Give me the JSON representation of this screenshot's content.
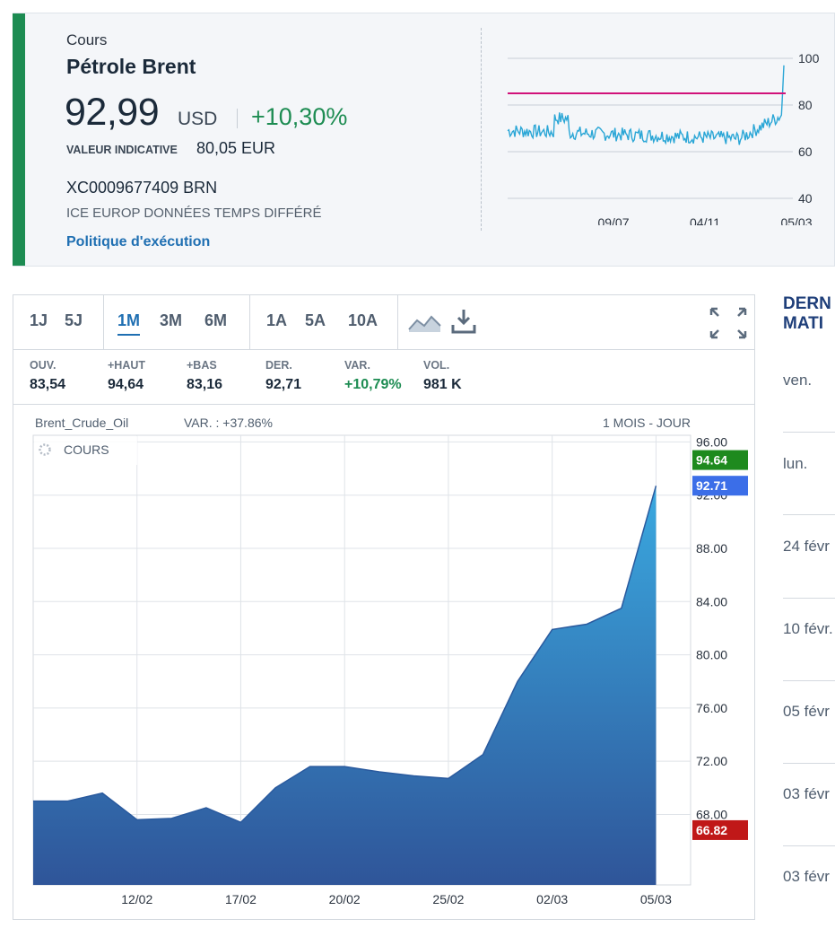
{
  "header": {
    "kicker": "Cours",
    "name": "Pétrole Brent",
    "price": "92,99",
    "currency": "USD",
    "change": "+10,30%",
    "indicative_label": "VALEUR INDICATIVE",
    "indicative_value": "80,05 EUR",
    "isin": "XC0009677409 BRN",
    "market": "ICE EUROP DONNÉES TEMPS DIFFÉRÉ",
    "link": "Politique d'exécution"
  },
  "mini_chart": {
    "y_ticks": [
      "100",
      "80",
      "60",
      "40"
    ],
    "x_ticks": [
      "09/07",
      "04/11",
      "05/03"
    ],
    "reference_level": 85
  },
  "toolbar": {
    "periods": [
      "1J",
      "5J",
      "1M",
      "3M",
      "6M",
      "1A",
      "5A",
      "10A"
    ],
    "active": "1M"
  },
  "stats": [
    {
      "label": "OUV.",
      "value": "83,54"
    },
    {
      "label": "+HAUT",
      "value": "94,64"
    },
    {
      "label": "+BAS",
      "value": "83,16"
    },
    {
      "label": "DER.",
      "value": "92,71"
    },
    {
      "label": "VAR.",
      "value": "+10,79%"
    },
    {
      "label": "VOL.",
      "value": "981 K"
    }
  ],
  "chart_header": {
    "instrument": "Brent_Crude_Oil",
    "variation": "VAR. : +37.86%",
    "period": "1 MOIS - JOUR",
    "series_label": "COURS"
  },
  "chart_data": {
    "type": "area",
    "x": [
      "09/02",
      "10/02",
      "11/02",
      "12/02",
      "13/02",
      "16/02",
      "17/02",
      "18/02",
      "19/02",
      "20/02",
      "23/02",
      "24/02",
      "25/02",
      "26/02",
      "27/02",
      "02/03",
      "03/03",
      "04/03",
      "05/03",
      "06/03"
    ],
    "x_ticks": [
      "12/02",
      "17/02",
      "20/02",
      "25/02",
      "02/03",
      "05/03"
    ],
    "y": [
      69.0,
      69.0,
      69.6,
      67.6,
      67.7,
      68.5,
      67.4,
      70.0,
      71.6,
      71.6,
      71.2,
      70.9,
      70.7,
      72.5,
      78.0,
      81.9,
      82.3,
      83.5,
      92.7
    ],
    "y_ticks": [
      "96.00",
      "92.00",
      "88.00",
      "84.00",
      "80.00",
      "76.00",
      "72.00",
      "68.00"
    ],
    "ylim": [
      62.7,
      96.5
    ],
    "markers": {
      "high": "94.64",
      "last": "92.71",
      "low": "66.82"
    },
    "grid": true
  },
  "side": {
    "title_line1": "DERN",
    "title_line2": "MATI",
    "items": [
      "ven.",
      "lun.",
      "24 févr",
      "10 févr.",
      "05 févr",
      "03 févr",
      "03 févr"
    ]
  },
  "colors": {
    "accent_green": "#1d8c52",
    "link_blue": "#1f6fb2",
    "area_top": "#3aa9e0",
    "area_bottom": "#2f5599",
    "high_marker": "#1e8a1e",
    "last_marker": "#3b6ee8",
    "low_marker": "#c01818",
    "mini_line": "#2aa6d6",
    "mini_ref": "#d1127a"
  }
}
